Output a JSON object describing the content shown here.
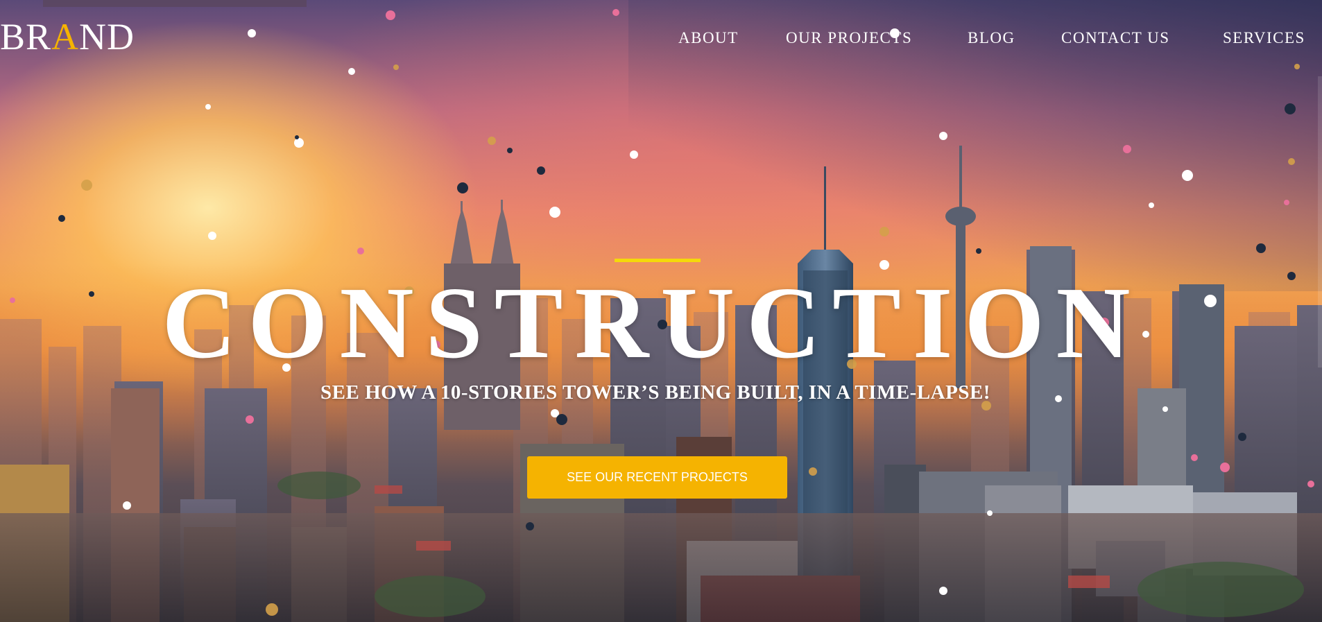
{
  "brand": {
    "prefix": "BR",
    "accent": "A",
    "suffix": "ND"
  },
  "nav": {
    "items": [
      "ABOUT",
      "OUR PROJECTS",
      "BLOG",
      "CONTACT US",
      "SERVICES"
    ]
  },
  "hero": {
    "headline": "CONSTRUCTION",
    "subheadline": "SEE HOW A 10-STORIES TOWER’S BEING BUILT, IN A TIME-LAPSE!",
    "cta_label": "SEE OUR RECENT PROJECTS"
  },
  "colors": {
    "accent": "#f5b301",
    "accent_line": "#f5d90a",
    "text": "#ffffff"
  }
}
